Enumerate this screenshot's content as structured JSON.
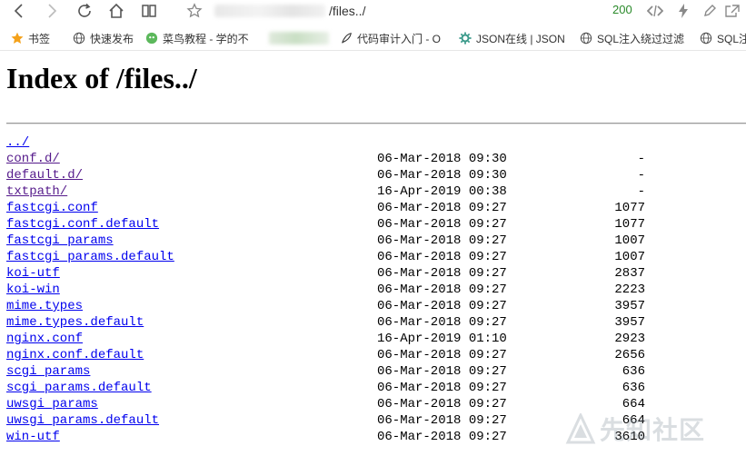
{
  "browser": {
    "url_path": "/files../",
    "status_code": "200"
  },
  "bookmarks": [
    {
      "label": "书签"
    },
    {
      "label": "快速发布"
    },
    {
      "label": "菜鸟教程 - 学的不"
    },
    {
      "label": "代码审计入门 - O"
    },
    {
      "label": "JSON在线 | JSON"
    },
    {
      "label": "SQL注入绕过过滤"
    },
    {
      "label": "SQL注"
    }
  ],
  "page": {
    "title": "Index of /files../"
  },
  "listing": [
    {
      "name": "../",
      "date": "",
      "size": ""
    },
    {
      "name": "conf.d/",
      "date": "06-Mar-2018 09:30",
      "size": "-"
    },
    {
      "name": "default.d/",
      "date": "06-Mar-2018 09:30",
      "size": "-"
    },
    {
      "name": "txtpath/",
      "date": "16-Apr-2019 00:38",
      "size": "-"
    },
    {
      "name": "fastcgi.conf",
      "date": "06-Mar-2018 09:27",
      "size": "1077"
    },
    {
      "name": "fastcgi.conf.default",
      "date": "06-Mar-2018 09:27",
      "size": "1077"
    },
    {
      "name": "fastcgi_params",
      "date": "06-Mar-2018 09:27",
      "size": "1007"
    },
    {
      "name": "fastcgi_params.default",
      "date": "06-Mar-2018 09:27",
      "size": "1007"
    },
    {
      "name": "koi-utf",
      "date": "06-Mar-2018 09:27",
      "size": "2837"
    },
    {
      "name": "koi-win",
      "date": "06-Mar-2018 09:27",
      "size": "2223"
    },
    {
      "name": "mime.types",
      "date": "06-Mar-2018 09:27",
      "size": "3957"
    },
    {
      "name": "mime.types.default",
      "date": "06-Mar-2018 09:27",
      "size": "3957"
    },
    {
      "name": "nginx.conf",
      "date": "16-Apr-2019 01:10",
      "size": "2923"
    },
    {
      "name": "nginx.conf.default",
      "date": "06-Mar-2018 09:27",
      "size": "2656"
    },
    {
      "name": "scgi_params",
      "date": "06-Mar-2018 09:27",
      "size": "636"
    },
    {
      "name": "scgi_params.default",
      "date": "06-Mar-2018 09:27",
      "size": "636"
    },
    {
      "name": "uwsgi_params",
      "date": "06-Mar-2018 09:27",
      "size": "664"
    },
    {
      "name": "uwsgi_params.default",
      "date": "06-Mar-2018 09:27",
      "size": "664"
    },
    {
      "name": "win-utf",
      "date": "06-Mar-2018 09:27",
      "size": "3610"
    }
  ],
  "watermark": {
    "text": "先知社区"
  },
  "colors": {
    "link": "#0000ee",
    "visited_link": "#551a8b",
    "status_ok": "#2a8a2a"
  }
}
